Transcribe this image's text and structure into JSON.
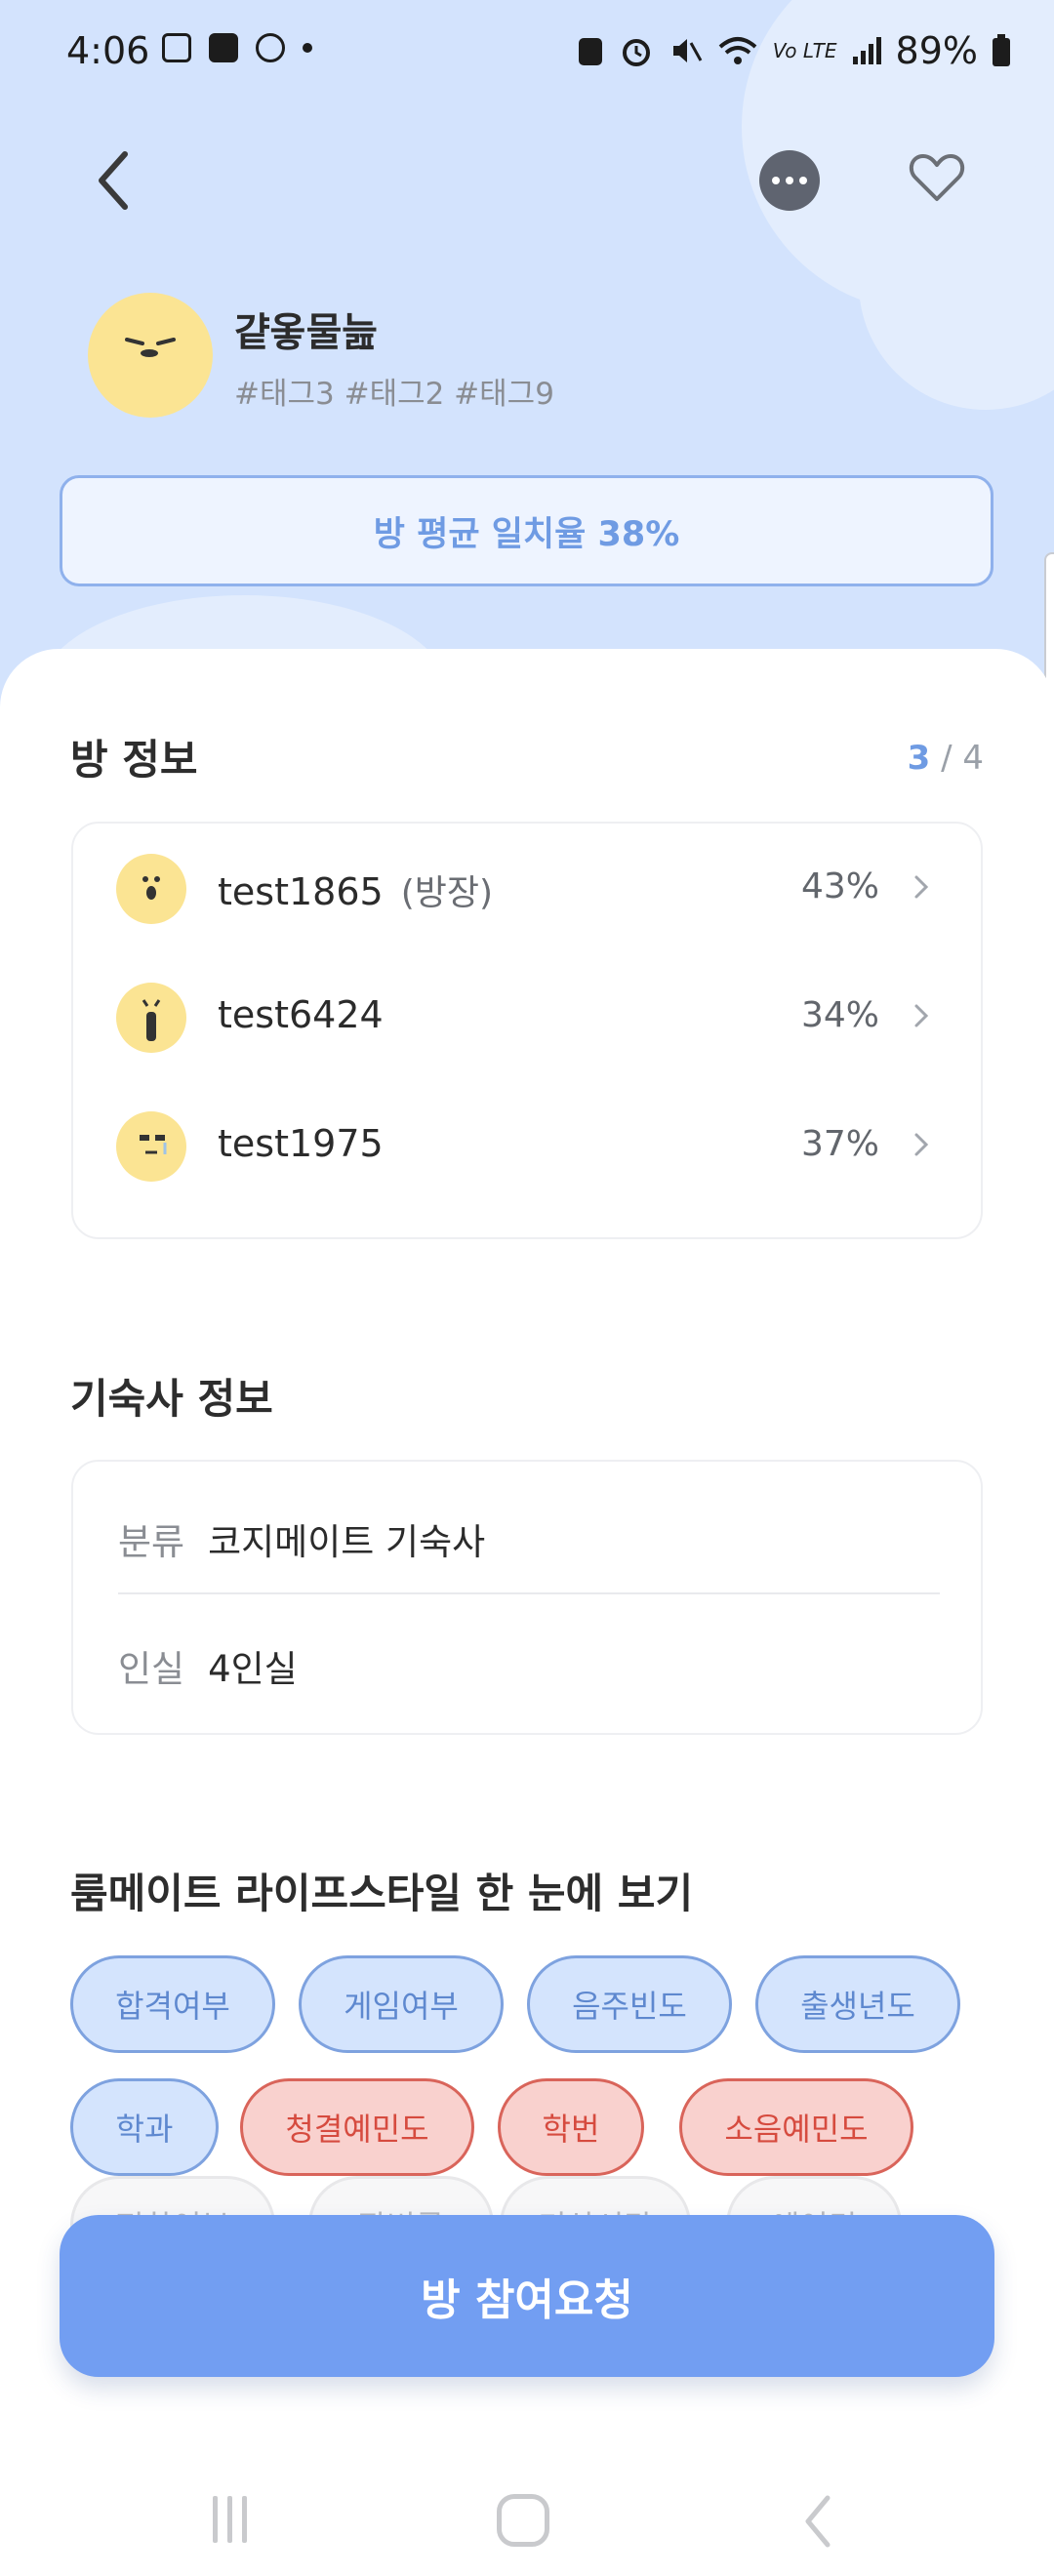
{
  "status": {
    "time": "4:06",
    "battery": "89%",
    "network_label": "Vo LTE"
  },
  "room": {
    "name": "걑옿물늞",
    "tags": "#태그3 #태그2 #태그9",
    "average_match": "방 평균 일치율 38%"
  },
  "room_info": {
    "title": "방 정보",
    "count_current": "3",
    "count_separator": " / ",
    "count_total": "4",
    "members": [
      {
        "name": "test1865",
        "role": "(방장)",
        "percent": "43%"
      },
      {
        "name": "test6424",
        "role": "",
        "percent": "34%"
      },
      {
        "name": "test1975",
        "role": "",
        "percent": "37%"
      }
    ]
  },
  "dorm_info": {
    "title": "기숙사 정보",
    "rows": [
      {
        "key": "분류",
        "value": "코지메이트 기숙사"
      },
      {
        "key": "인실",
        "value": "4인실"
      }
    ]
  },
  "lifestyle": {
    "title": "룸메이트 라이프스타일 한 눈에 보기",
    "chips": [
      {
        "label": "합격여부",
        "color": "blue"
      },
      {
        "label": "게임여부",
        "color": "blue"
      },
      {
        "label": "음주빈도",
        "color": "blue"
      },
      {
        "label": "출생년도",
        "color": "blue"
      },
      {
        "label": "학과",
        "color": "blue"
      },
      {
        "label": "청결예민도",
        "color": "red"
      },
      {
        "label": "학번",
        "color": "red"
      },
      {
        "label": "소음예민도",
        "color": "red"
      },
      {
        "label": "전화여부",
        "color": "faded"
      },
      {
        "label": "잠버릇",
        "color": "faded"
      },
      {
        "label": "기상시간",
        "color": "faded"
      },
      {
        "label": "에어컨",
        "color": "faded"
      }
    ]
  },
  "cta": {
    "label": "방 참여요청"
  },
  "colors": {
    "accent": "#729ef2",
    "chip_blue": "#d4e4fd",
    "chip_red": "#f9d1ce",
    "hero_bg": "#d3e3fd",
    "avatar": "#fbe493"
  },
  "icons": [
    "back-icon",
    "chat-icon",
    "heart-icon",
    "chevron-right-icon",
    "recent-apps-icon",
    "home-icon",
    "nav-back-icon"
  ]
}
